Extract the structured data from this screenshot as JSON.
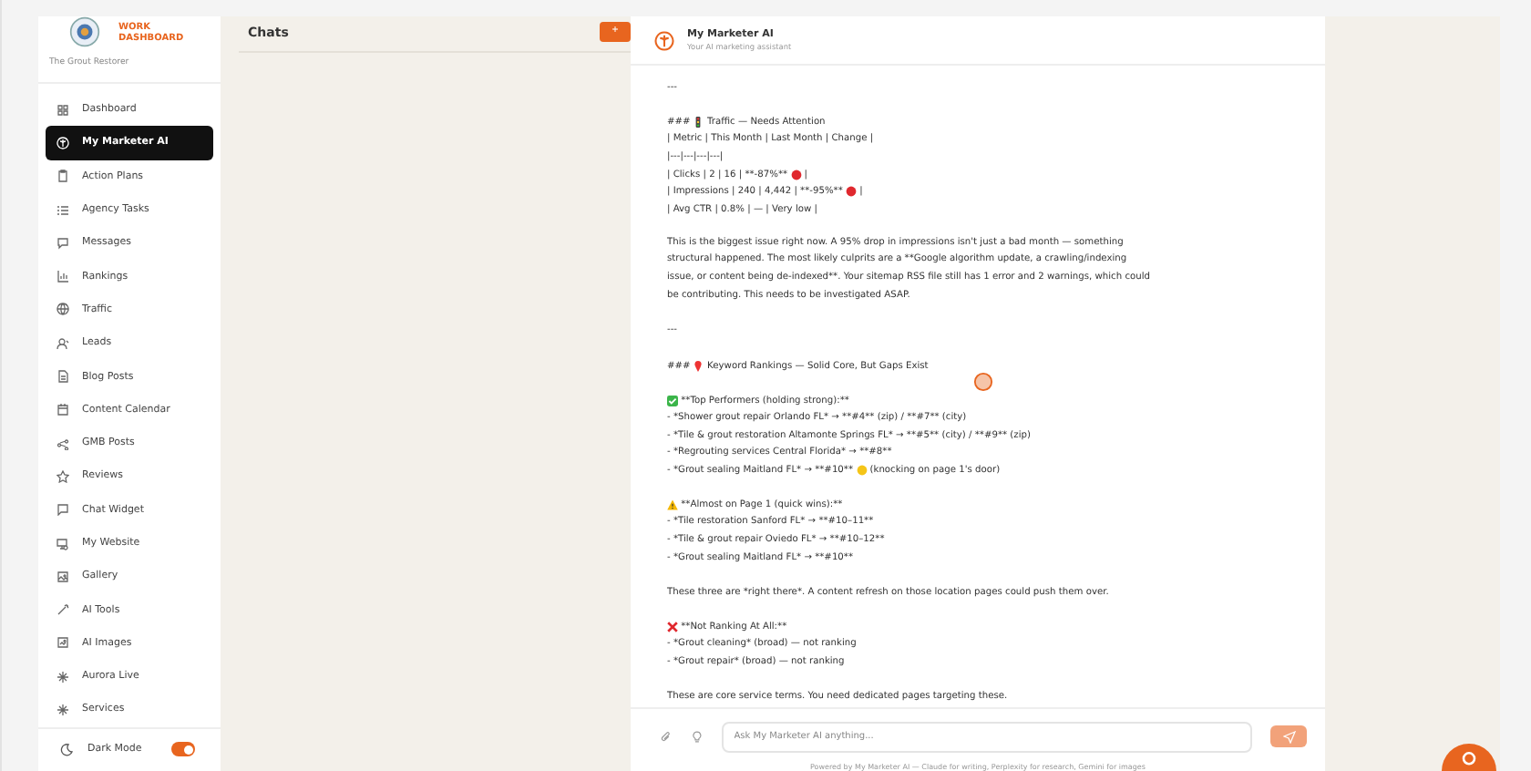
{
  "brand": {
    "line1": "WORK",
    "line2": "DASHBOARD",
    "client": "The Grout Restorer"
  },
  "sidebar": {
    "items": [
      {
        "label": "Dashboard",
        "selected": false
      },
      {
        "label": "My Marketer AI",
        "selected": true
      },
      {
        "label": "Action Plans",
        "selected": false
      },
      {
        "label": "Agency Tasks",
        "selected": false
      },
      {
        "label": "Messages",
        "selected": false
      },
      {
        "label": "Rankings",
        "selected": false
      },
      {
        "label": "Traffic",
        "selected": false
      },
      {
        "label": "Leads",
        "selected": false
      },
      {
        "label": "Blog Posts",
        "selected": false
      },
      {
        "label": "Content Calendar",
        "selected": false
      },
      {
        "label": "GMB Posts",
        "selected": false
      },
      {
        "label": "Reviews",
        "selected": false
      },
      {
        "label": "Chat Widget",
        "selected": false
      },
      {
        "label": "My Website",
        "selected": false
      },
      {
        "label": "Gallery",
        "selected": false
      },
      {
        "label": "AI Tools",
        "selected": false
      },
      {
        "label": "AI Images",
        "selected": false
      },
      {
        "label": "Aurora Live",
        "selected": false
      },
      {
        "label": "Services",
        "selected": false
      }
    ],
    "dark_mode": {
      "label": "Dark Mode",
      "on": true
    }
  },
  "chats": {
    "title": "Chats",
    "new_button": "+"
  },
  "chat": {
    "title": "My Marketer AI",
    "subtitle": "Your AI marketing assistant",
    "blocks": [
      {
        "lines": [
          [
            {
              "kind": "text",
              "text": "---"
            }
          ]
        ]
      },
      {
        "lines": [
          [
            {
              "kind": "text",
              "text": "### "
            },
            {
              "kind": "traffic-light"
            },
            {
              "kind": "text",
              "text": " Traffic — Needs Attention"
            }
          ],
          [
            {
              "kind": "text",
              "text": "| Metric | This Month | Last Month | Change |"
            }
          ],
          [
            {
              "kind": "text",
              "text": "|---|---|---|---|"
            }
          ],
          [
            {
              "kind": "text",
              "text": "| Clicks | 2 | 16 | **-87%** "
            },
            {
              "kind": "red-dot"
            },
            {
              "kind": "text",
              "text": " |"
            }
          ],
          [
            {
              "kind": "text",
              "text": "| Impressions | 240 | 4,442 | **-95%** "
            },
            {
              "kind": "red-dot"
            },
            {
              "kind": "text",
              "text": " |"
            }
          ],
          [
            {
              "kind": "text",
              "text": "| Avg CTR | 0.8% | — | Very low |"
            }
          ]
        ]
      },
      {
        "lines": [
          [
            {
              "kind": "paragraph",
              "text": "This is the biggest issue right now. A 95% drop in impressions isn't just a bad month — something structural happened. The most likely culprits are a **Google algorithm update, a crawling/indexing issue, or content being de-indexed**. Your sitemap RSS file still has 1 error and 2 warnings, which could be contributing. This needs to be investigated ASAP."
            }
          ]
        ]
      },
      {
        "lines": [
          [
            {
              "kind": "text",
              "text": "---"
            }
          ]
        ]
      },
      {
        "lines": [
          [
            {
              "kind": "text",
              "text": "### "
            },
            {
              "kind": "pin"
            },
            {
              "kind": "text",
              "text": " Keyword Rankings — Solid Core, But Gaps Exist"
            }
          ]
        ]
      },
      {
        "lines": [
          [
            {
              "kind": "check"
            },
            {
              "kind": "text",
              "text": " **Top Performers (holding strong):**"
            }
          ],
          [
            {
              "kind": "text",
              "text": "- *Shower grout repair Orlando FL* → **#4** (zip) / **#7** (city)"
            }
          ],
          [
            {
              "kind": "text",
              "text": "- *Tile & grout restoration Altamonte Springs FL* → **#5** (city) / **#9** (zip)"
            }
          ],
          [
            {
              "kind": "text",
              "text": "- *Regrouting services Central Florida* → **#8**"
            }
          ],
          [
            {
              "kind": "text",
              "text": "- *Grout sealing Maitland FL* → **#10** "
            },
            {
              "kind": "yellow-dot"
            },
            {
              "kind": "text",
              "text": " (knocking on page 1's door)"
            }
          ]
        ]
      },
      {
        "lines": [
          [
            {
              "kind": "warning"
            },
            {
              "kind": "text",
              "text": " **Almost on Page 1 (quick wins):**"
            }
          ],
          [
            {
              "kind": "text",
              "text": "- *Tile restoration Sanford FL* → **#10–11**"
            }
          ],
          [
            {
              "kind": "text",
              "text": "- *Tile & grout repair Oviedo FL* → **#10–12**"
            }
          ],
          [
            {
              "kind": "text",
              "text": "- *Grout sealing Maitland FL* → **#10**"
            }
          ]
        ]
      },
      {
        "lines": [
          [
            {
              "kind": "text",
              "text": "These three are *right there*. A content refresh on those location pages could push them over."
            }
          ]
        ]
      },
      {
        "lines": [
          [
            {
              "kind": "cross"
            },
            {
              "kind": "text",
              "text": " **Not Ranking At All:**"
            }
          ],
          [
            {
              "kind": "text",
              "text": "- *Grout cleaning* (broad) — not ranking"
            }
          ],
          [
            {
              "kind": "text",
              "text": "- *Grout repair* (broad) — not ranking"
            }
          ]
        ]
      },
      {
        "lines": [
          [
            {
              "kind": "text",
              "text": "These are core service terms. You need dedicated pages targeting these."
            }
          ]
        ]
      }
    ],
    "input": {
      "placeholder": "Ask My Marketer AI anything..."
    },
    "footer": "Powered by My Marketer AI — Claude for writing, Perplexity for research, Gemini for images"
  }
}
